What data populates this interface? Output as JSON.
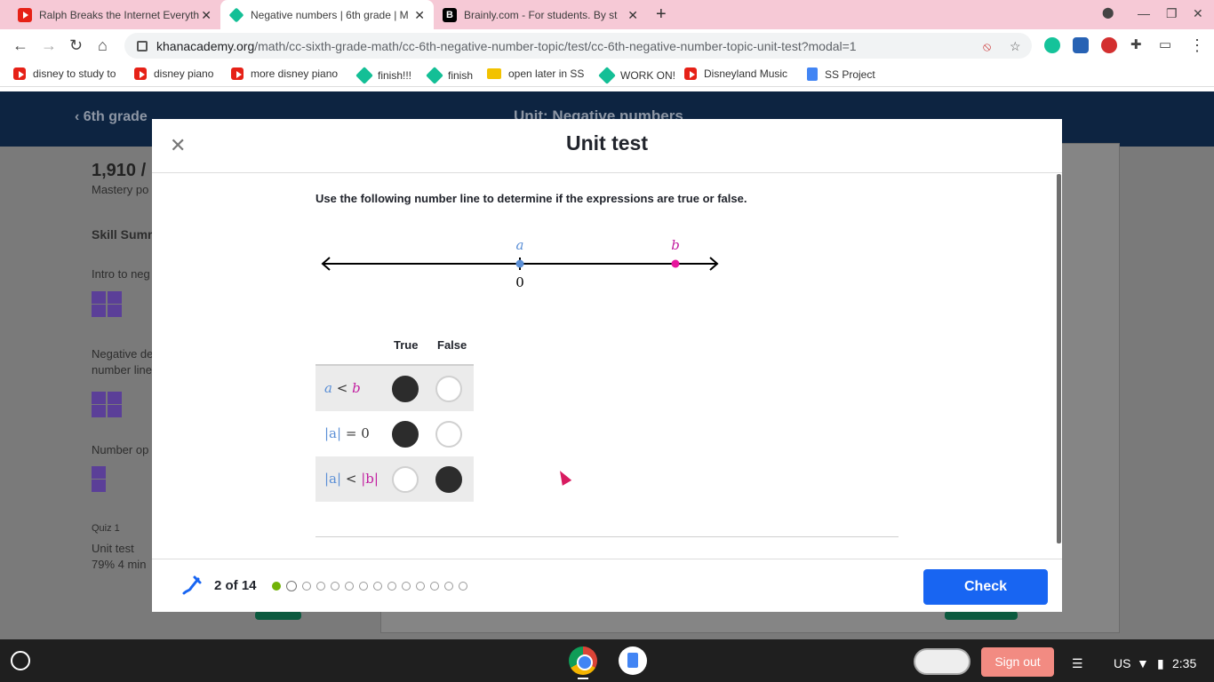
{
  "browser": {
    "tabs": [
      {
        "title": "Ralph Breaks the Internet Everyth",
        "icon": "youtube-icon",
        "active": false
      },
      {
        "title": "Negative numbers | 6th grade | M",
        "icon": "khan-academy-icon",
        "active": true
      },
      {
        "title": "Brainly.com - For students. By st",
        "icon": "brainly-icon",
        "active": false
      }
    ],
    "url_host": "khanacademy.org",
    "url_path": "/math/cc-sixth-grade-math/cc-6th-negative-number-topic/test/cc-6th-negative-number-topic-unit-test?modal=1",
    "bookmarks": [
      {
        "label": "disney to study to",
        "icon": "youtube-icon"
      },
      {
        "label": "disney piano",
        "icon": "youtube-icon"
      },
      {
        "label": "more disney piano",
        "icon": "youtube-icon"
      },
      {
        "label": "finish!!!",
        "icon": "khan-academy-icon"
      },
      {
        "label": "finish",
        "icon": "khan-academy-icon"
      },
      {
        "label": "open later in SS",
        "icon": "folder-icon"
      },
      {
        "label": "WORK ON!",
        "icon": "khan-academy-icon"
      },
      {
        "label": "Disneyland Music",
        "icon": "youtube-icon"
      },
      {
        "label": "SS Project",
        "icon": "docs-icon"
      }
    ]
  },
  "background_page": {
    "back_label": "6th grade",
    "unit_title": "Unit: Negative numbers",
    "points": "1,910 /",
    "points_label": "Mastery po",
    "skill_summary": "Skill Summ",
    "items": [
      "Intro to neg",
      "Negative de",
      "number line",
      "Number op",
      "Quiz 1",
      "Unit test",
      "79% 4 min"
    ]
  },
  "modal": {
    "title": "Unit test",
    "question": "Use the following number line to determine if the expressions are true or false.",
    "number_line": {
      "label_a": "a",
      "label_b": "b",
      "zero_label": "0"
    },
    "table": {
      "header_true": "True",
      "header_false": "False",
      "rows": [
        {
          "lhs": "a",
          "op": "<",
          "rhs": "b",
          "selected": "true"
        },
        {
          "lhs": "|a|",
          "op": "=",
          "rhs": "0",
          "selected": "true"
        },
        {
          "lhs": "|a|",
          "op": "<",
          "rhs": "|b|",
          "selected": "false"
        }
      ]
    },
    "progress_label": "2 of 14",
    "total_questions": 14,
    "current_question": 2,
    "check_label": "Check"
  },
  "shelf": {
    "sign_out_label": "Sign out",
    "locale": "US",
    "time": "2:35"
  },
  "colors": {
    "variable_a": "#5b8fd6",
    "variable_b": "#c21ea0",
    "check_button": "#1865f2",
    "progress_done": "#71b307"
  }
}
